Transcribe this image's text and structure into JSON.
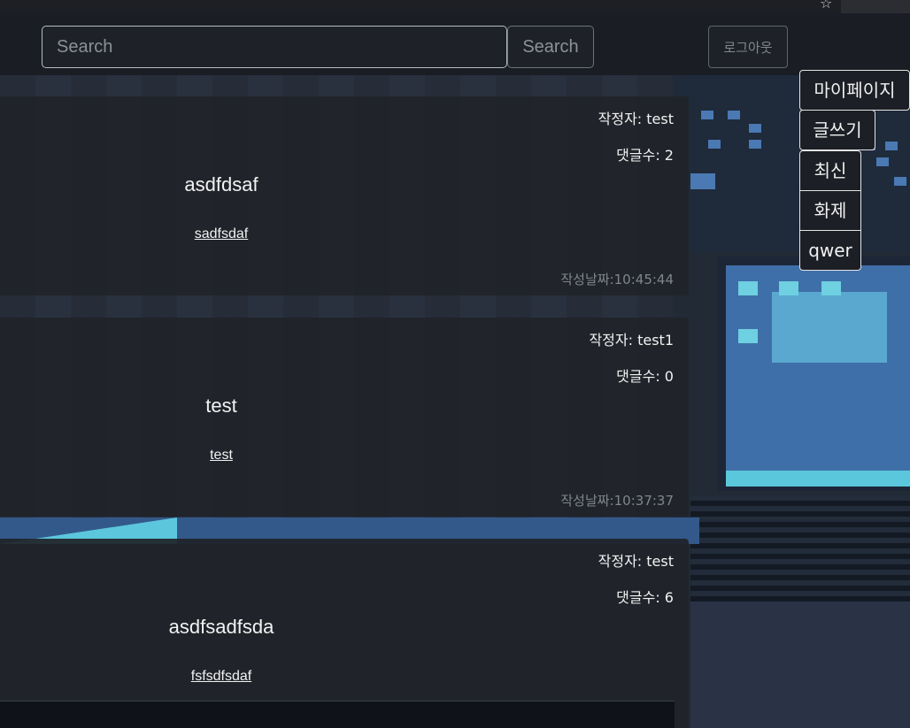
{
  "search": {
    "placeholder": "Search",
    "button_label": "Search"
  },
  "header": {
    "logout_label": "로그아웃"
  },
  "side_menu": {
    "mypage_label": "마이페이지",
    "write_label": "글쓰기",
    "latest_label": "최신",
    "hot_label": "화제",
    "custom_label": "qwer"
  },
  "posts": [
    {
      "author": "작정자: test",
      "comments": "댓글수: 2",
      "title": "asdfdsaf",
      "body": "sadfsdaf",
      "date": "작성날짜:10:45:44"
    },
    {
      "author": "작정자: test1",
      "comments": "댓글수: 0",
      "title": "test",
      "body": "test",
      "date": "작성날짜:10:37:37"
    },
    {
      "author": "작정자: test",
      "comments": "댓글수: 6",
      "title": "asdfsadfsda",
      "body": "fsfsdfsdaf",
      "date": ""
    }
  ],
  "icons": {
    "bookmark": "star-icon"
  },
  "colors": {
    "border_light": "#e4e4e4",
    "card_bg": "#202329",
    "date_gray": "#7f858c"
  }
}
